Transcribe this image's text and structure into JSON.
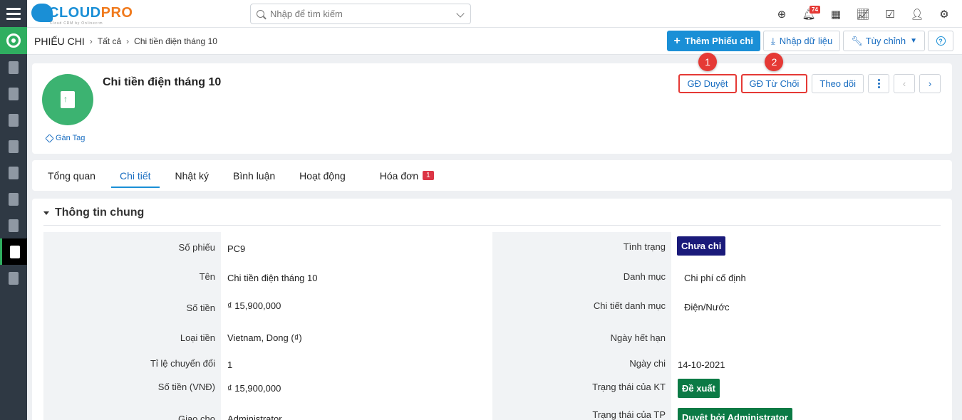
{
  "app": {
    "brand_a": "CLOUD",
    "brand_b": "PRO",
    "brand_sub": "Cloud CRM by Onlinecrm",
    "search_placeholder": "Nhập để tìm kiếm",
    "notification_count": "74",
    "colors": {
      "primary": "#1a8fd6",
      "green": "#2fae60",
      "danger": "#e53935",
      "sidebar": "#2f3944"
    }
  },
  "topbar_icons": [
    "plus-circle-icon",
    "bell-icon",
    "calendar-icon",
    "chart-icon",
    "checkbox-icon",
    "user-icon",
    "gear-icon"
  ],
  "breadcrumb": {
    "module": "PHIẾU CHI",
    "list": "Tất cả",
    "record": "Chi tiền điện tháng 10"
  },
  "toolbar": {
    "add_label": "Thêm Phiếu chi",
    "import_label": "Nhập dữ liệu",
    "customize_label": "Tùy chỉnh",
    "help_label": "?"
  },
  "record": {
    "title": "Chi tiền điện tháng 10",
    "tag_label": "Gán Tag",
    "actions": {
      "approve": "GĐ Duyệt",
      "reject": "GĐ Từ Chối",
      "follow": "Theo dõi",
      "marker_1": "1",
      "marker_2": "2"
    }
  },
  "tabs": [
    {
      "label": "Tổng quan"
    },
    {
      "label": "Chi tiết"
    },
    {
      "label": "Nhật ký"
    },
    {
      "label": "Bình luận"
    },
    {
      "label": "Hoạt động"
    },
    {
      "label": "Hóa đơn",
      "badge": "1"
    }
  ],
  "section": {
    "title": "Thông tin chung",
    "left": [
      {
        "label": "Số phiếu",
        "value": "PC9"
      },
      {
        "label": "Tên",
        "value": "Chi tiền điện tháng 10"
      },
      {
        "label": "Số tiền",
        "value": "₫ 15,900,000"
      },
      {
        "label": "Loại tiền",
        "value": "Vietnam, Dong (₫)"
      },
      {
        "label": "Tỉ lệ chuyển đổi",
        "value": "1"
      },
      {
        "label": "Số tiền (VNĐ)",
        "value": "₫ 15,900,000"
      },
      {
        "label": "Giao cho",
        "value": "Administrator"
      }
    ],
    "right": [
      {
        "label": "Tình trạng",
        "value": "Chưa chi",
        "pill_color": "#1a1a7a"
      },
      {
        "label": "Danh mục",
        "value": "Chi phí cố định"
      },
      {
        "label": "Chi tiết danh mục",
        "value": "Điện/Nước"
      },
      {
        "label": "Ngày hết hạn",
        "value": ""
      },
      {
        "label": "Ngày chi",
        "value": "14-10-2021"
      },
      {
        "label": "Trạng thái của KT",
        "value": "Đề xuất",
        "pill_color": "#0b7a45"
      },
      {
        "label": "Trạng thái của TP",
        "value": "Duyệt bởi Administrator",
        "pill_color": "#0b7a45"
      }
    ]
  }
}
